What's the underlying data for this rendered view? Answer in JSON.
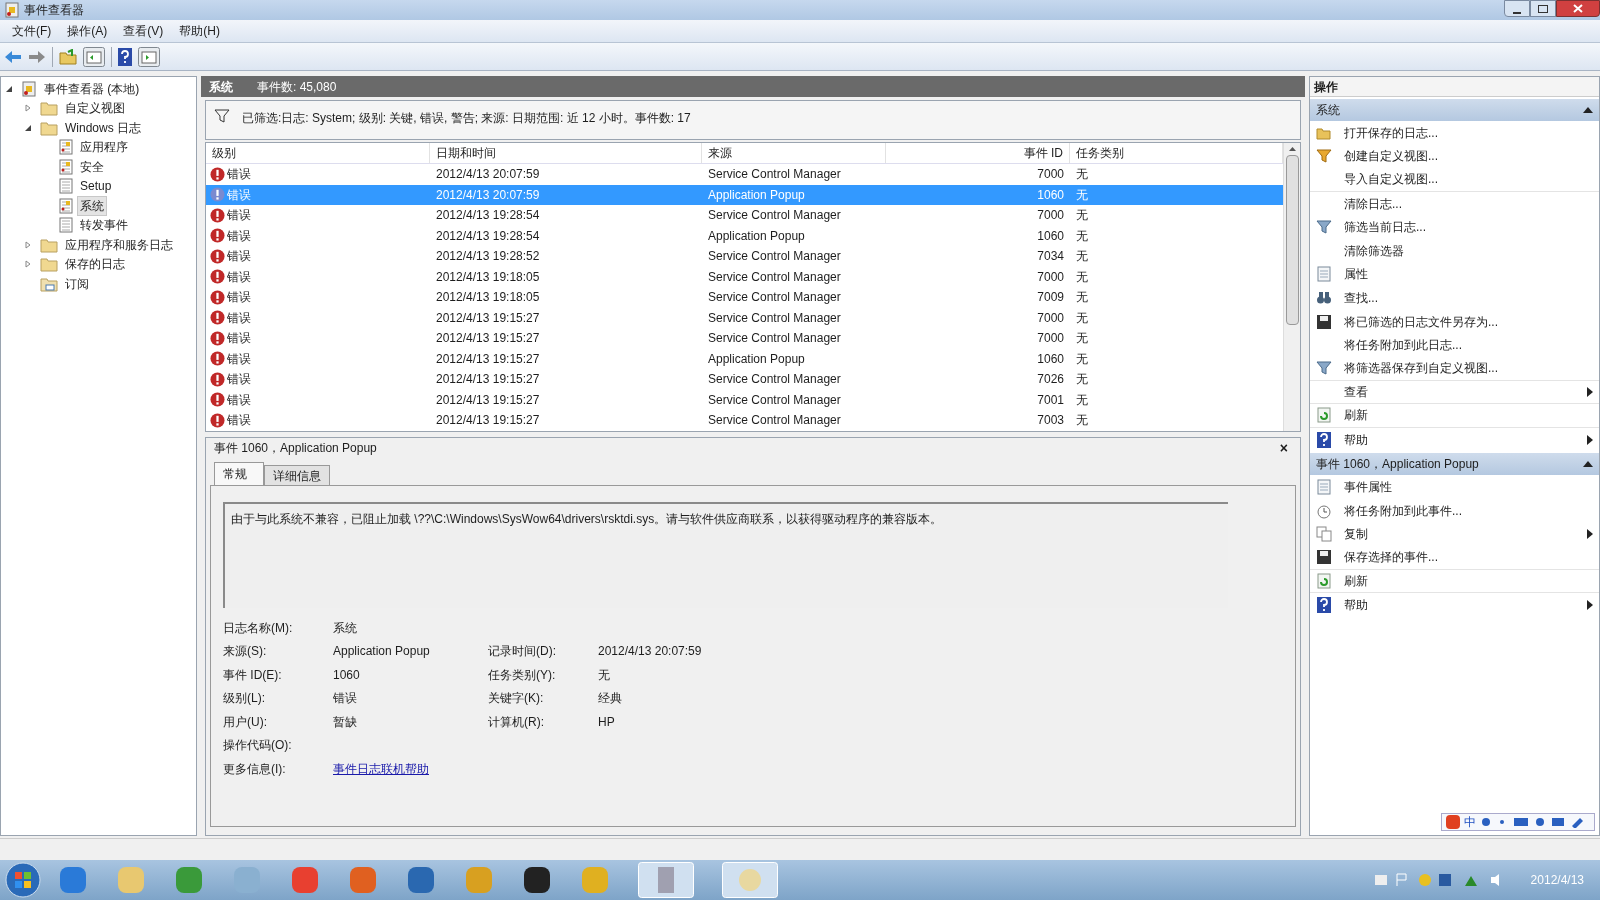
{
  "window": {
    "title": "事件查看器"
  },
  "menu": [
    "文件(F)",
    "操作(A)",
    "查看(V)",
    "帮助(H)"
  ],
  "tree": {
    "label": "事件查看器 (本地)",
    "kind": "root",
    "expanded": true,
    "selected": false,
    "children": [
      {
        "label": "自定义视图",
        "kind": "folder",
        "expanded": false,
        "selected": false
      },
      {
        "label": "Windows 日志",
        "kind": "folder",
        "expanded": true,
        "selected": false,
        "children": [
          {
            "label": "应用程序",
            "kind": "log",
            "selected": false
          },
          {
            "label": "安全",
            "kind": "log",
            "selected": false
          },
          {
            "label": "Setup",
            "kind": "plain",
            "selected": false
          },
          {
            "label": "系统",
            "kind": "log",
            "selected": true
          },
          {
            "label": "转发事件",
            "kind": "plain",
            "selected": false
          }
        ]
      },
      {
        "label": "应用程序和服务日志",
        "kind": "folder",
        "expanded": false,
        "selected": false
      },
      {
        "label": "保存的日志",
        "kind": "folder",
        "expanded": false,
        "selected": false
      },
      {
        "label": "订阅",
        "kind": "leaf",
        "selected": false
      }
    ]
  },
  "log_header": {
    "name": "系统",
    "count": "事件数: 45,080"
  },
  "filter_text": "已筛选:日志: System; 级别: 关键, 错误, 警告; 来源: 日期范围: 近 12 小时。事件数: 17",
  "table": {
    "columns": [
      "级别",
      "日期和时间",
      "来源",
      "事件 ID",
      "任务类别"
    ],
    "rows": [
      {
        "level": "错误",
        "time": "2012/4/13 20:07:59",
        "source": "Service Control Manager",
        "id": "7000",
        "category": "无",
        "selected": false
      },
      {
        "level": "错误",
        "time": "2012/4/13 20:07:59",
        "source": "Application Popup",
        "id": "1060",
        "category": "无",
        "selected": true
      },
      {
        "level": "错误",
        "time": "2012/4/13 19:28:54",
        "source": "Service Control Manager",
        "id": "7000",
        "category": "无",
        "selected": false
      },
      {
        "level": "错误",
        "time": "2012/4/13 19:28:54",
        "source": "Application Popup",
        "id": "1060",
        "category": "无",
        "selected": false
      },
      {
        "level": "错误",
        "time": "2012/4/13 19:28:52",
        "source": "Service Control Manager",
        "id": "7034",
        "category": "无",
        "selected": false
      },
      {
        "level": "错误",
        "time": "2012/4/13 19:18:05",
        "source": "Service Control Manager",
        "id": "7000",
        "category": "无",
        "selected": false
      },
      {
        "level": "错误",
        "time": "2012/4/13 19:18:05",
        "source": "Service Control Manager",
        "id": "7009",
        "category": "无",
        "selected": false
      },
      {
        "level": "错误",
        "time": "2012/4/13 19:15:27",
        "source": "Service Control Manager",
        "id": "7000",
        "category": "无",
        "selected": false
      },
      {
        "level": "错误",
        "time": "2012/4/13 19:15:27",
        "source": "Service Control Manager",
        "id": "7000",
        "category": "无",
        "selected": false
      },
      {
        "level": "错误",
        "time": "2012/4/13 19:15:27",
        "source": "Application Popup",
        "id": "1060",
        "category": "无",
        "selected": false
      },
      {
        "level": "错误",
        "time": "2012/4/13 19:15:27",
        "source": "Service Control Manager",
        "id": "7026",
        "category": "无",
        "selected": false
      },
      {
        "level": "错误",
        "time": "2012/4/13 19:15:27",
        "source": "Service Control Manager",
        "id": "7001",
        "category": "无",
        "selected": false
      },
      {
        "level": "错误",
        "time": "2012/4/13 19:15:27",
        "source": "Service Control Manager",
        "id": "7003",
        "category": "无",
        "selected": false
      }
    ]
  },
  "detail": {
    "title": "事件 1060，Application Popup",
    "close": "×",
    "tabs": [
      {
        "label": "常规",
        "selected": true
      },
      {
        "label": "详细信息",
        "selected": false
      }
    ],
    "message": "由于与此系统不兼容，已阻止加载 \\??\\C:\\Windows\\SysWow64\\drivers\\rsktdi.sys。请与软件供应商联系，以获得驱动程序的兼容版本。",
    "rows": [
      [
        {
          "label": "日志名称(M):",
          "value": "系统"
        }
      ],
      [
        {
          "label": "来源(S):",
          "value": "Application Popup"
        },
        {
          "label": "记录时间(D):",
          "value": "2012/4/13 20:07:59"
        }
      ],
      [
        {
          "label": "事件 ID(E):",
          "value": "1060"
        },
        {
          "label": "任务类别(Y):",
          "value": "无"
        }
      ],
      [
        {
          "label": "级别(L):",
          "value": "错误"
        },
        {
          "label": "关键字(K):",
          "value": "经典"
        }
      ],
      [
        {
          "label": "用户(U):",
          "value": "暂缺"
        },
        {
          "label": "计算机(R):",
          "value": "HP"
        }
      ],
      [
        {
          "label": "操作代码(O):"
        }
      ],
      [
        {
          "label": "更多信息(I):",
          "value": "事件日志联机帮助",
          "kind": "link"
        }
      ]
    ]
  },
  "actions": {
    "title": "操作",
    "sections": [
      {
        "title": "系统",
        "items": [
          {
            "label": "打开保存的日志...",
            "kind": "open",
            "submenu": false,
            "divider": false
          },
          {
            "label": "创建自定义视图...",
            "kind": "funnel",
            "submenu": false,
            "divider": false
          },
          {
            "label": "导入自定义视图...",
            "kind": "none",
            "submenu": false,
            "divider": true
          },
          {
            "label": "清除日志...",
            "kind": "none",
            "submenu": false,
            "divider": false
          },
          {
            "label": "筛选当前日志...",
            "kind": "filter",
            "submenu": false,
            "divider": false
          },
          {
            "label": "清除筛选器",
            "kind": "none",
            "submenu": false,
            "divider": false
          },
          {
            "label": "属性",
            "kind": "page",
            "submenu": false,
            "divider": false
          },
          {
            "label": "查找...",
            "kind": "find",
            "submenu": false,
            "divider": false
          },
          {
            "label": "将已筛选的日志文件另存为...",
            "kind": "save",
            "submenu": false,
            "divider": false
          },
          {
            "label": "将任务附加到此日志...",
            "kind": "none",
            "submenu": false,
            "divider": false
          },
          {
            "label": "将筛选器保存到自定义视图...",
            "kind": "filter",
            "submenu": false,
            "divider": true
          },
          {
            "label": "查看",
            "kind": "none",
            "submenu": true,
            "divider": true
          },
          {
            "label": "刷新",
            "kind": "refresh",
            "submenu": false,
            "divider": true
          },
          {
            "label": "帮助",
            "kind": "help",
            "submenu": true,
            "divider": false
          }
        ]
      },
      {
        "title": "事件 1060，Application Popup",
        "items": [
          {
            "label": "事件属性",
            "kind": "page",
            "submenu": false,
            "divider": false
          },
          {
            "label": "将任务附加到此事件...",
            "kind": "clock",
            "submenu": false,
            "divider": false
          },
          {
            "label": "复制",
            "kind": "copy",
            "submenu": true,
            "divider": false
          },
          {
            "label": "保存选择的事件...",
            "kind": "save",
            "submenu": false,
            "divider": true
          },
          {
            "label": "刷新",
            "kind": "refresh",
            "submenu": false,
            "divider": true
          },
          {
            "label": "帮助",
            "kind": "help",
            "submenu": true,
            "divider": false
          }
        ]
      }
    ]
  },
  "ime": {
    "mode": "中"
  },
  "clock": {
    "date": "2012/4/13"
  }
}
